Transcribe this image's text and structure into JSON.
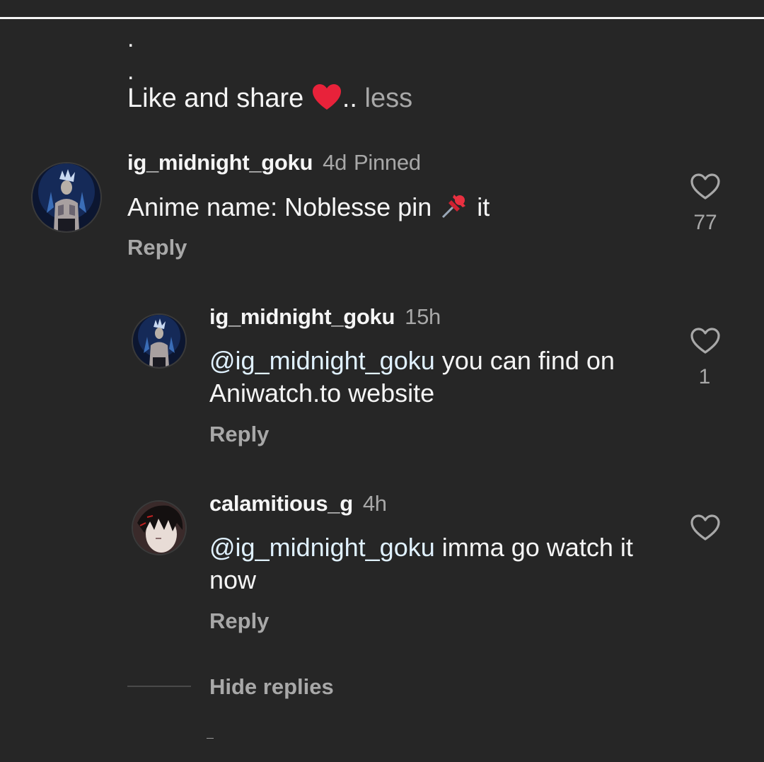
{
  "caption": {
    "dot1": ".",
    "dot2": ".",
    "text": "Like and share ",
    "ellipsis": "..",
    "less_label": "less"
  },
  "comments": [
    {
      "username": "ig_midnight_goku",
      "time": "4d",
      "pinned_label": "Pinned",
      "text": "Anime name: Noblesse pin ",
      "text_end": " it",
      "reply_label": "Reply",
      "like_count": "77"
    },
    {
      "username": "ig_midnight_goku",
      "time": "15h",
      "mention": "@ig_midnight_goku",
      "text": " you can find on Aniwatch.to website",
      "reply_label": "Reply",
      "like_count": "1"
    },
    {
      "username": "calamitious_g",
      "time": "4h",
      "mention": "@ig_midnight_goku",
      "text": " imma go watch it now",
      "reply_label": "Reply",
      "like_count": ""
    }
  ],
  "hide_replies_label": "Hide replies",
  "icons": {
    "heart_emoji": "red-heart-emoji",
    "pin_emoji": "pushpin-emoji",
    "like": "heart-outline-icon"
  },
  "colors": {
    "background": "#262626",
    "text_primary": "#f5f5f5",
    "text_secondary": "#a8a8a8",
    "mention": "#e0f1ff",
    "heart_red": "#e0245e"
  }
}
